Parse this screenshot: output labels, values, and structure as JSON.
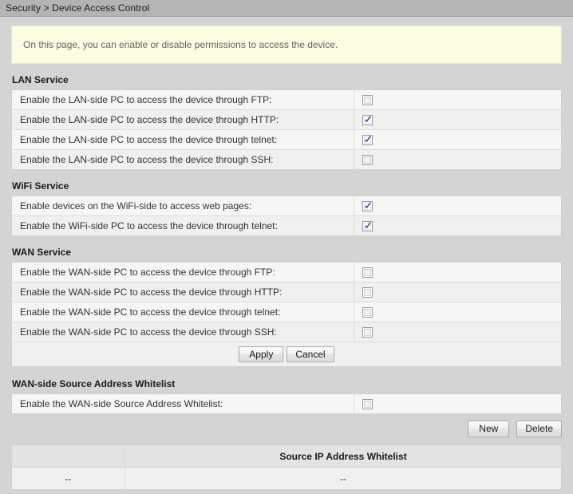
{
  "breadcrumb": {
    "text": "Security > Device Access Control"
  },
  "info": {
    "message": "On this page, you can enable or disable permissions to access the device."
  },
  "sections": [
    {
      "title": "LAN Service",
      "rows": [
        {
          "label": "Enable the LAN-side PC to access the device through FTP:",
          "checked": false
        },
        {
          "label": "Enable the LAN-side PC to access the device through HTTP:",
          "checked": true
        },
        {
          "label": "Enable the LAN-side PC to access the device through telnet:",
          "checked": true
        },
        {
          "label": "Enable the LAN-side PC to access the device through SSH:",
          "checked": false
        }
      ]
    },
    {
      "title": "WiFi Service",
      "rows": [
        {
          "label": "Enable devices on the WiFi-side to access web pages:",
          "checked": true
        },
        {
          "label": "Enable the WiFi-side PC to access the device through telnet:",
          "checked": true
        }
      ]
    },
    {
      "title": "WAN Service",
      "rows": [
        {
          "label": "Enable the WAN-side PC to access the device through FTP:",
          "checked": false
        },
        {
          "label": "Enable the WAN-side PC to access the device through HTTP:",
          "checked": false
        },
        {
          "label": "Enable the WAN-side PC to access the device through telnet:",
          "checked": false
        },
        {
          "label": "Enable the WAN-side PC to access the device through SSH:",
          "checked": false
        }
      ]
    }
  ],
  "form_buttons": {
    "apply_label": "Apply",
    "cancel_label": "Cancel"
  },
  "whitelist": {
    "title": "WAN-side Source Address Whitelist",
    "enable_row": {
      "label": "Enable the WAN-side Source Address Whitelist:",
      "checked": false
    },
    "toolbar": {
      "new_label": "New",
      "delete_label": "Delete"
    },
    "table": {
      "headers": [
        "",
        "Source IP Address Whitelist"
      ],
      "rows": [
        [
          "--",
          "--"
        ]
      ]
    }
  },
  "icons": {
    "checkmark": "✓"
  },
  "colors": {
    "page_background": "#d4d4d4",
    "header_bar": "#b4b4b4",
    "banner_background": "#fcfce0",
    "banner_border": "#e6e6c8",
    "row_odd": "#f6f6f6",
    "row_even": "#f0f0f0",
    "check_color": "#3a5fa8"
  }
}
